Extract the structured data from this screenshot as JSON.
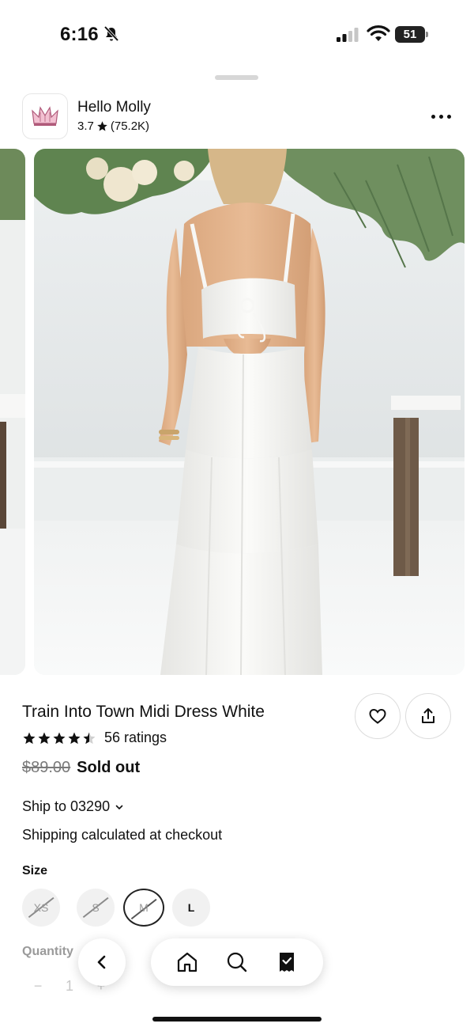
{
  "status_bar": {
    "time": "6:16",
    "battery": "51"
  },
  "store": {
    "name": "Hello Molly",
    "rating": "3.7",
    "review_count": "(75.2K)",
    "logo_icon": "crown-icon"
  },
  "product": {
    "title": "Train Into Town Midi Dress White",
    "stars": 4.5,
    "ratings_text": "56 ratings",
    "original_price": "$89.00",
    "status": "Sold out",
    "image_icon": "white-dress-photo"
  },
  "shipping": {
    "ship_to": "Ship to 03290",
    "note": "Shipping calculated at checkout"
  },
  "size": {
    "label": "Size",
    "options": [
      {
        "label": "XS",
        "available": false,
        "selected": false
      },
      {
        "label": "S",
        "available": false,
        "selected": false
      },
      {
        "label": "M",
        "available": false,
        "selected": true
      },
      {
        "label": "L",
        "available": true,
        "selected": false
      }
    ]
  },
  "quantity": {
    "label": "Quantity",
    "value": "1",
    "decrement": "−",
    "increment": "+"
  },
  "nav": {
    "back_icon": "chevron-left-icon",
    "tabs": [
      "home-icon",
      "search-icon",
      "receipt-icon"
    ]
  },
  "colors": {
    "text": "#111111",
    "muted": "#7a7a7a",
    "chip_bg": "#f1f1f1"
  }
}
